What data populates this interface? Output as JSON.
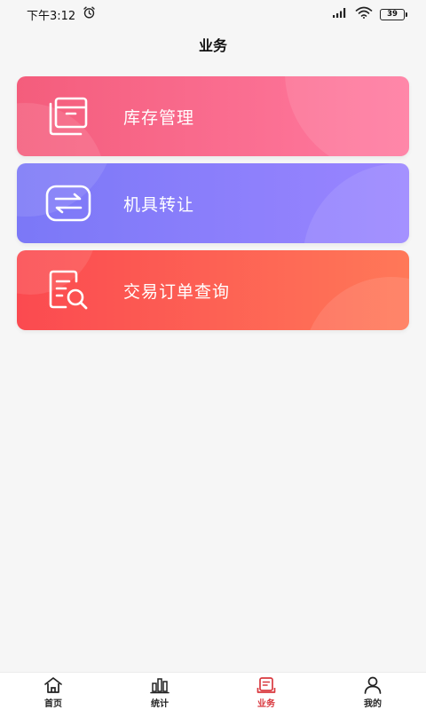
{
  "status_bar": {
    "time": "下午3:12",
    "battery": "39"
  },
  "header": {
    "title": "业务"
  },
  "cards": [
    {
      "label": "库存管理",
      "icon": "inventory-box-icon",
      "color_from": "#f45d7c",
      "color_to": "#ff80a0"
    },
    {
      "label": "机具转让",
      "icon": "transfer-arrows-icon",
      "color_from": "#7e76fb",
      "color_to": "#9c86ff"
    },
    {
      "label": "交易订单查询",
      "icon": "order-search-icon",
      "color_from": "#fb4a4f",
      "color_to": "#ff7a58"
    }
  ],
  "tab_bar": {
    "active_color": "#d9393f",
    "tabs": [
      {
        "label": "首页",
        "icon": "home-icon"
      },
      {
        "label": "统计",
        "icon": "bar-chart-icon"
      },
      {
        "label": "业务",
        "icon": "business-icon",
        "active": true
      },
      {
        "label": "我的",
        "icon": "person-icon"
      }
    ]
  }
}
